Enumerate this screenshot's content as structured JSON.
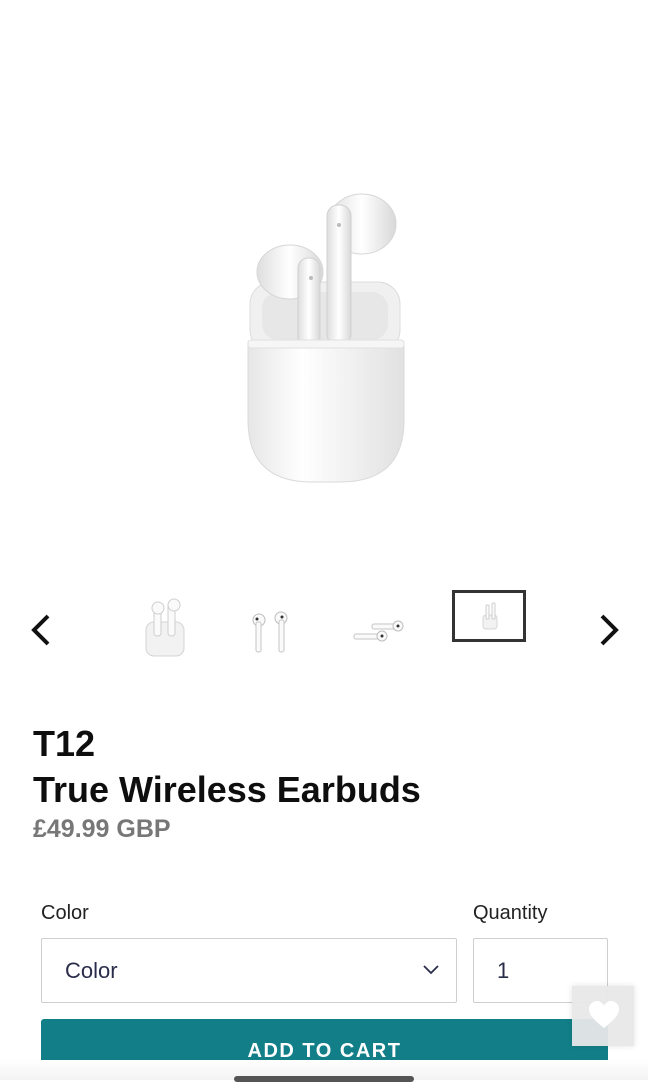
{
  "gallery": {
    "main_image": "earbuds-in-case-open",
    "thumbnails": [
      {
        "name": "thumb-case-with-earbuds",
        "active": false
      },
      {
        "name": "thumb-earbuds-pair",
        "active": false
      },
      {
        "name": "thumb-earbuds-lying",
        "active": false
      },
      {
        "name": "thumb-small-case",
        "active": true
      }
    ],
    "prev_icon": "chevron-left-icon",
    "next_icon": "chevron-right-icon"
  },
  "product": {
    "model": "T12",
    "name": "True Wireless Earbuds",
    "price": "£49.99 GBP"
  },
  "options": {
    "color_label": "Color",
    "color_value": "Color",
    "quantity_label": "Quantity",
    "quantity_value": "1"
  },
  "actions": {
    "add_to_cart": "ADD TO CART"
  },
  "wishlist": {
    "icon": "heart-icon"
  },
  "colors": {
    "cta": "#127f88",
    "price": "#777777",
    "select_text": "#2a2d4a"
  }
}
